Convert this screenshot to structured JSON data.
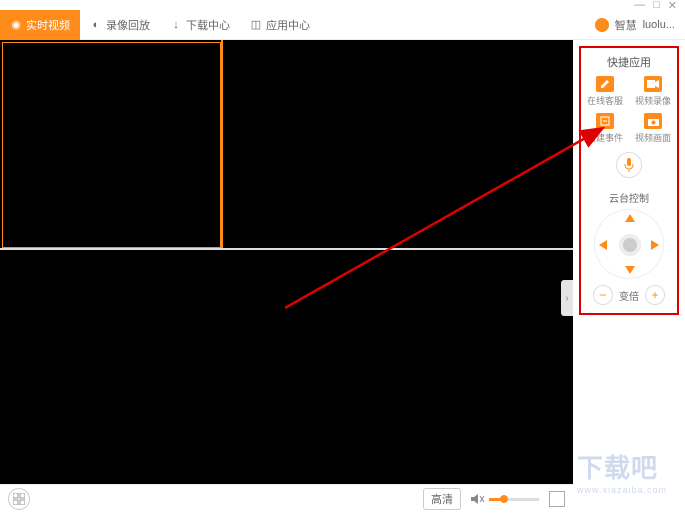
{
  "window": {
    "min": "—",
    "max": "□",
    "close": "✕"
  },
  "toolbar": {
    "realtime": "实时视频",
    "playback": "录像回放",
    "download": "下载中心",
    "apps": "应用中心",
    "brand": "智慧",
    "user": "luolu..."
  },
  "sidebar": {
    "quick_title": "快捷应用",
    "items": [
      {
        "label": "在线客服"
      },
      {
        "label": "视频录像"
      },
      {
        "label": "创建事件"
      },
      {
        "label": "视频画面"
      }
    ],
    "ptz_title": "云台控制",
    "zoom_label": "变倍"
  },
  "bottom": {
    "quality": "高清"
  },
  "watermark": {
    "text": "下载吧",
    "url": "www.xiazaiba.com"
  },
  "colors": {
    "accent": "#ff8c1a",
    "annot": "#d00"
  }
}
